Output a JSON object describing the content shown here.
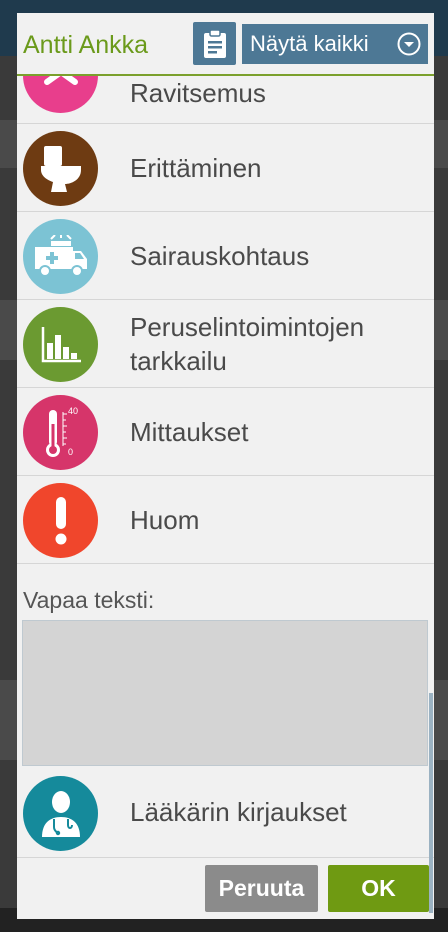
{
  "header": {
    "patient_name": "Antti Ankka",
    "show_all_label": "Näytä kaikki"
  },
  "categories": [
    {
      "label": "Ravitsemus",
      "color": "#e83e8c",
      "icon": "no-food-icon"
    },
    {
      "label": "Erittäminen",
      "color": "#6e3b12",
      "icon": "toilet-icon"
    },
    {
      "label": "Sairauskohtaus",
      "color": "#7cc3d4",
      "icon": "ambulance-icon"
    },
    {
      "label": "Peruselintoimintojen tarkkailu",
      "color": "#6b9a31",
      "icon": "bar-chart-icon"
    },
    {
      "label": "Mittaukset",
      "color": "#d6356a",
      "icon": "thermometer-icon"
    },
    {
      "label": "Huom",
      "color": "#f0462c",
      "icon": "exclamation-icon"
    }
  ],
  "thermometer_scale": {
    "top": "40",
    "bottom": "0"
  },
  "free_text": {
    "label": "Vapaa teksti:",
    "value": ""
  },
  "doctor_entry": {
    "label": "Lääkärin kirjaukset",
    "color": "#158a9b",
    "icon": "doctor-icon"
  },
  "footer": {
    "cancel_label": "Peruuta",
    "ok_label": "OK"
  },
  "colors": {
    "accent_green": "#6f9a12",
    "header_blue": "#4d7895",
    "cancel_gray": "#8b8b8b"
  }
}
